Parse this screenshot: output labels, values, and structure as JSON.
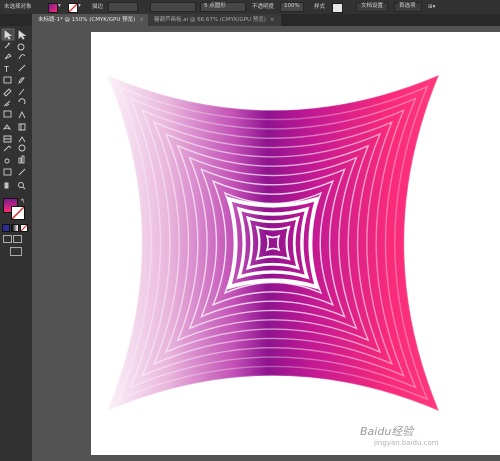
{
  "control_bar": {
    "selection_label": "未选择对象",
    "stroke_label": "描边",
    "brush_label": "5 点圆形",
    "opacity_label": "不透明度",
    "opacity_value": "100%",
    "style_label": "样式",
    "doc_setup_button": "文档设置",
    "preferences_button": "首选项"
  },
  "tabs": [
    {
      "label": "未标题-1* @ 150% (CMYK/GPU 预览)",
      "close": "×"
    },
    {
      "label": "糖葫芦画板.ai @ 66.67% (CMYK/GPU 预览)",
      "close": "×"
    }
  ],
  "watermark": {
    "logo_text": "Baidu经验",
    "url": "jingyan.baidu.com"
  },
  "colors": {
    "fill_gradient_start": "#7b1d8a",
    "fill_gradient_end": "#ff2b7a",
    "artwork_light": "#f4dff0",
    "artwork_mid": "#9b1c9a",
    "artwork_right": "#ff2a75"
  },
  "tool_icons": [
    "selection-icon",
    "direct-selection-icon",
    "magic-wand-icon",
    "lasso-icon",
    "pen-icon",
    "curvature-icon",
    "type-icon",
    "line-icon",
    "rectangle-icon",
    "paintbrush-icon",
    "shaper-icon",
    "pencil-icon",
    "eraser-icon",
    "rotate-icon",
    "scale-icon",
    "width-icon",
    "free-transform-icon",
    "shape-builder-icon",
    "perspective-icon",
    "mesh-icon",
    "gradient-icon",
    "eyedropper-icon",
    "blend-icon",
    "symbol-sprayer-icon",
    "column-graph-icon",
    "artboard-icon",
    "slice-icon",
    "hand-icon",
    "zoom-icon"
  ]
}
